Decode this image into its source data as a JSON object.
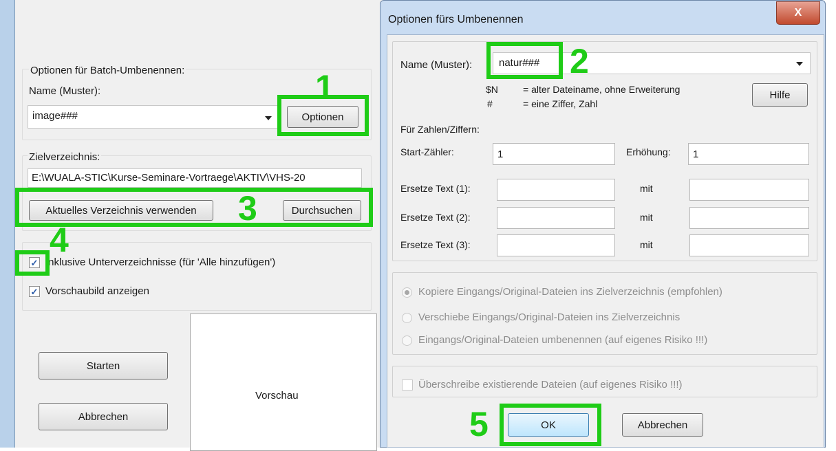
{
  "left": {
    "batch_group_title": "Optionen für Batch-Umbenennen:",
    "name_label": "Name (Muster):",
    "name_value": "image###",
    "options_button": "Optionen",
    "target_dir_label": "Zielverzeichnis:",
    "target_dir_value": "E:\\WUALA-STIC\\Kurse-Seminare-Vortraege\\AKTIV\\VHS-20",
    "use_current_dir_button": "Aktuelles Verzeichnis verwenden",
    "browse_button": "Durchsuchen",
    "include_subdirs_label": "Inklusive Unterverzeichnisse (für 'Alle hinzufügen')",
    "include_subdirs_checked": true,
    "show_preview_label": "Vorschaubild anzeigen",
    "show_preview_checked": true,
    "start_button": "Starten",
    "cancel_button": "Abbrechen",
    "preview_label": "Vorschau"
  },
  "dialog": {
    "title": "Optionen fürs Umbenennen",
    "close_glyph": "X",
    "name_label": "Name (Muster):",
    "name_value": "natur###",
    "hint_n_key": "$N",
    "hint_n_text": "= alter Dateiname, ohne Erweiterung",
    "hint_hash_key": "#",
    "hint_hash_text": "= eine Ziffer, Zahl",
    "help_button": "Hilfe",
    "numbers_title": "Für Zahlen/Ziffern:",
    "start_counter_label": "Start-Zähler:",
    "start_counter_value": "1",
    "increment_label": "Erhöhung:",
    "increment_value": "1",
    "replace_rows": [
      {
        "label": "Ersetze Text (1):",
        "with": "mit"
      },
      {
        "label": "Ersetze Text (2):",
        "with": "mit"
      },
      {
        "label": "Ersetze Text (3):",
        "with": "mit"
      }
    ],
    "radio_options": [
      {
        "label": "Kopiere Eingangs/Original-Dateien ins Zielverzeichnis (empfohlen)",
        "selected": true
      },
      {
        "label": "Verschiebe Eingangs/Original-Dateien ins Zielverzeichnis",
        "selected": false
      },
      {
        "label": "Eingangs/Original-Dateien umbenennen (auf eigenes Risiko !!!)",
        "selected": false
      }
    ],
    "overwrite_label": "Überschreibe existierende Dateien (auf eigenes Risiko !!!)",
    "overwrite_checked": false,
    "ok_button": "OK",
    "cancel_button": "Abbrechen"
  },
  "annotations": {
    "step1": "1",
    "step2": "2",
    "step3": "3",
    "step4": "4",
    "step5": "5",
    "highlight_color": "#1fcc17"
  }
}
